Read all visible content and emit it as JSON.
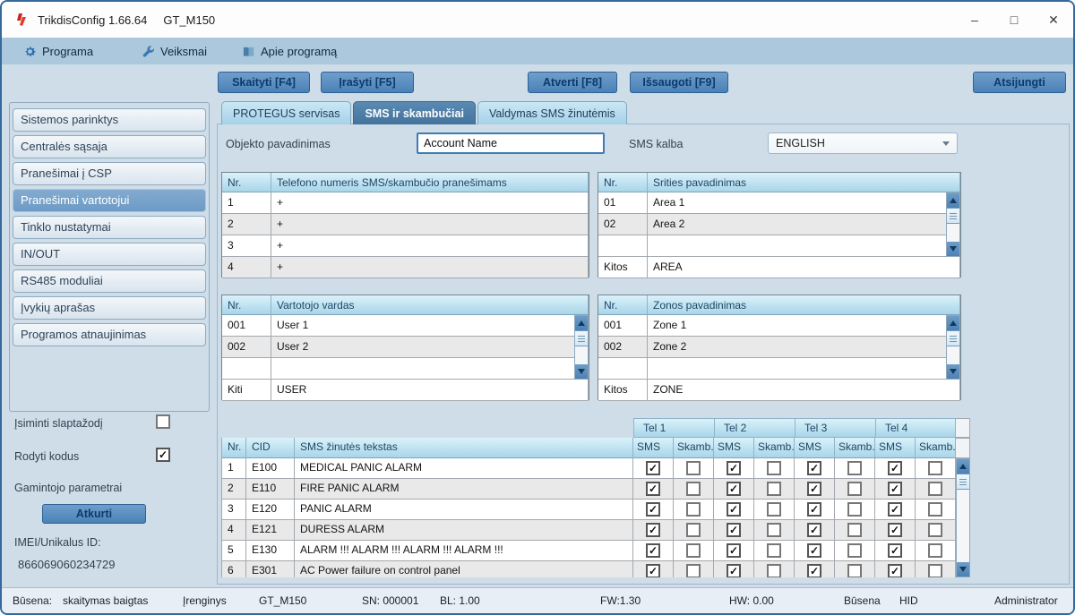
{
  "window": {
    "app_title": "TrikdisConfig 1.66.64",
    "device_title": "GT_M150",
    "controls": {
      "minimize": "–",
      "maximize": "□",
      "close": "✕"
    }
  },
  "menu": {
    "items": [
      {
        "label": "Programa",
        "icon": "gear-icon"
      },
      {
        "label": "Veiksmai",
        "icon": "wrench-icon"
      },
      {
        "label": "Apie programą",
        "icon": "book-icon"
      }
    ]
  },
  "toolbar": {
    "read": "Skaityti [F4]",
    "write": "Įrašyti [F5]",
    "open": "Atverti [F8]",
    "save": "Išsaugoti [F9]",
    "disconnect": "Atsijungti"
  },
  "tabs": [
    {
      "label": "PROTEGUS servisas",
      "active": false
    },
    {
      "label": "SMS ir skambučiai",
      "active": true
    },
    {
      "label": "Valdymas SMS žinutėmis",
      "active": false
    }
  ],
  "sidebar": {
    "selected_index": 3,
    "items": [
      "Sistemos parinktys",
      "Centralės sąsaja",
      "Pranešimai į CSP",
      "Pranešimai vartotojui",
      "Tinklo nustatymai",
      "IN/OUT",
      "RS485 moduliai",
      "Įvykių aprašas",
      "Programos atnaujinimas"
    ]
  },
  "options": {
    "remember_password": {
      "label": "Įsiminti slaptažodį",
      "checked": false
    },
    "show_codes": {
      "label": "Rodyti kodus",
      "checked": true
    },
    "manufacturer_label": "Gamintojo parametrai",
    "restore_button": "Atkurti",
    "imei_label": "IMEI/Unikalus ID:",
    "imei_value": "866069060234729"
  },
  "form": {
    "object_name_label": "Objekto pavadinimas",
    "object_name_value": "Account Name",
    "sms_language_label": "SMS kalba",
    "sms_language_value": "ENGLISH"
  },
  "tables": {
    "phones": {
      "headers": [
        "Nr.",
        "Telefono numeris SMS/skambučio pranešimams"
      ],
      "rows": [
        [
          "1",
          "+"
        ],
        [
          "2",
          "+"
        ],
        [
          "3",
          "+"
        ],
        [
          "4",
          "+"
        ]
      ]
    },
    "areas": {
      "headers": [
        "Nr.",
        "Srities pavadinimas"
      ],
      "rows": [
        [
          "01",
          "Area 1"
        ],
        [
          "02",
          "Area 2"
        ],
        [
          "",
          ""
        ]
      ],
      "footer": [
        "Kitos",
        "AREA"
      ]
    },
    "users": {
      "headers": [
        "Nr.",
        "Vartotojo vardas"
      ],
      "rows": [
        [
          "001",
          "User 1"
        ],
        [
          "002",
          "User 2"
        ],
        [
          "",
          ""
        ]
      ],
      "footer": [
        "Kiti",
        "USER"
      ]
    },
    "zones": {
      "headers": [
        "Nr.",
        "Zonos pavadinimas"
      ],
      "rows": [
        [
          "001",
          "Zone 1"
        ],
        [
          "002",
          "Zone 2"
        ],
        [
          "",
          ""
        ]
      ],
      "footer": [
        "Kitos",
        "ZONE"
      ]
    },
    "events": {
      "tel_groups": [
        "Tel 1",
        "Tel 2",
        "Tel 3",
        "Tel 4"
      ],
      "col_headers": [
        "Nr.",
        "CID",
        "SMS žinutės tekstas"
      ],
      "check_headers": [
        "SMS",
        "Skamb."
      ],
      "rows": [
        {
          "nr": "1",
          "cid": "E100",
          "text": "MEDICAL PANIC ALARM",
          "checks": [
            true,
            false,
            true,
            false,
            true,
            false,
            true,
            false
          ]
        },
        {
          "nr": "2",
          "cid": "E110",
          "text": "FIRE PANIC ALARM",
          "checks": [
            true,
            false,
            true,
            false,
            true,
            false,
            true,
            false
          ]
        },
        {
          "nr": "3",
          "cid": "E120",
          "text": "PANIC ALARM",
          "checks": [
            true,
            false,
            true,
            false,
            true,
            false,
            true,
            false
          ]
        },
        {
          "nr": "4",
          "cid": "E121",
          "text": "DURESS ALARM",
          "checks": [
            true,
            false,
            true,
            false,
            true,
            false,
            true,
            false
          ]
        },
        {
          "nr": "5",
          "cid": "E130",
          "text": "ALARM !!! ALARM !!! ALARM !!! ALARM !!!",
          "checks": [
            true,
            false,
            true,
            false,
            true,
            false,
            true,
            false
          ]
        },
        {
          "nr": "6",
          "cid": "E301",
          "text": "AC Power failure on control panel",
          "checks": [
            true,
            false,
            true,
            false,
            true,
            false,
            true,
            false
          ]
        }
      ]
    }
  },
  "statusbar": {
    "items": [
      "Būsena:",
      "skaitymas baigtas",
      "Įrenginys",
      "GT_M150",
      "SN: 000001",
      "BL:  1.00",
      "FW:1.30",
      "HW:  0.00",
      "Būsena",
      "HID",
      "Administrator"
    ]
  },
  "colors": {
    "accent_blue": "#4a82b6",
    "header_blue": "#a9d5e9",
    "selected_nav": "#6d9ac4",
    "menu_bar": "#abc8dc",
    "background": "#cfdde9",
    "logo_red": "#d02a1e"
  }
}
